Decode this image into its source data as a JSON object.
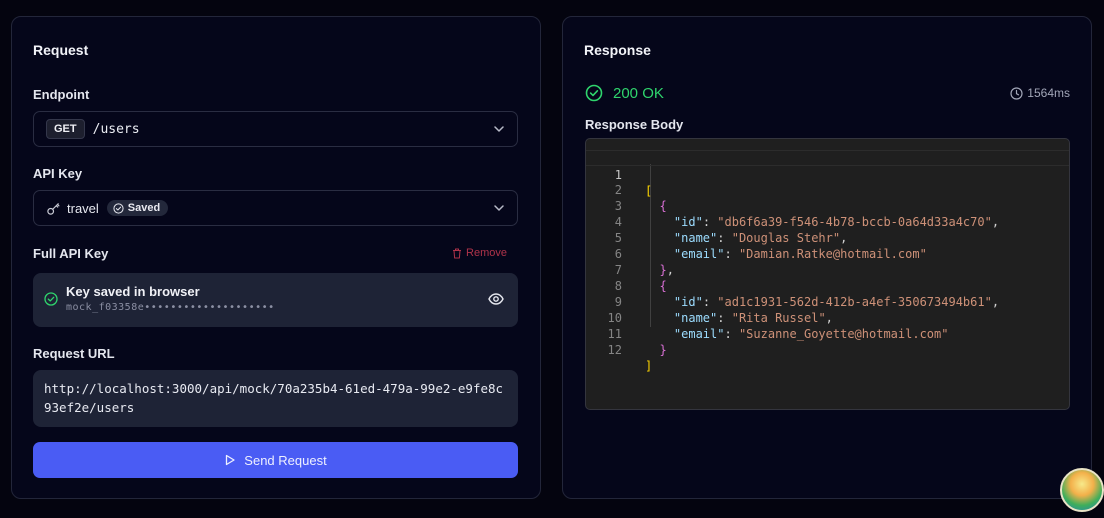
{
  "request": {
    "title": "Request",
    "endpoint_label": "Endpoint",
    "method": "GET",
    "path": "/users",
    "api_key_label": "API Key",
    "api_key_name": "travel",
    "saved_badge": "Saved",
    "full_key_label": "Full API Key",
    "remove_label": "Remove",
    "key_saved_title": "Key saved in browser",
    "key_masked": "mock_f03358e••••••••••••••••••••",
    "request_url_label": "Request URL",
    "request_url": "http://localhost:3000/api/mock/70a235b4-61ed-479a-99e2-e9fe8c93ef2e/users",
    "send_label": "Send Request"
  },
  "response": {
    "title": "Response",
    "status": "200 OK",
    "status_color": "#2fd56d",
    "time": "1564ms",
    "body_label": "Response Body",
    "line_numbers": [
      "1",
      "2",
      "3",
      "4",
      "5",
      "6",
      "7",
      "8",
      "9",
      "10",
      "11",
      "12"
    ],
    "records": [
      {
        "id": "db6f6a39-f546-4b78-bccb-0a64d33a4c70",
        "name": "Douglas Stehr",
        "email": "Damian.Ratke@hotmail.com"
      },
      {
        "id": "ad1c1931-562d-412b-a4ef-350673494b61",
        "name": "Rita Russel",
        "email": "Suzanne_Goyette@hotmail.com"
      }
    ]
  },
  "colors": {
    "accent": "#4a5cf4",
    "danger": "#b0334a",
    "success": "#2fd56d"
  },
  "icons": [
    "chevron-down-icon",
    "key-icon",
    "check-circle-icon",
    "trash-icon",
    "eye-icon",
    "play-icon",
    "clock-icon"
  ]
}
